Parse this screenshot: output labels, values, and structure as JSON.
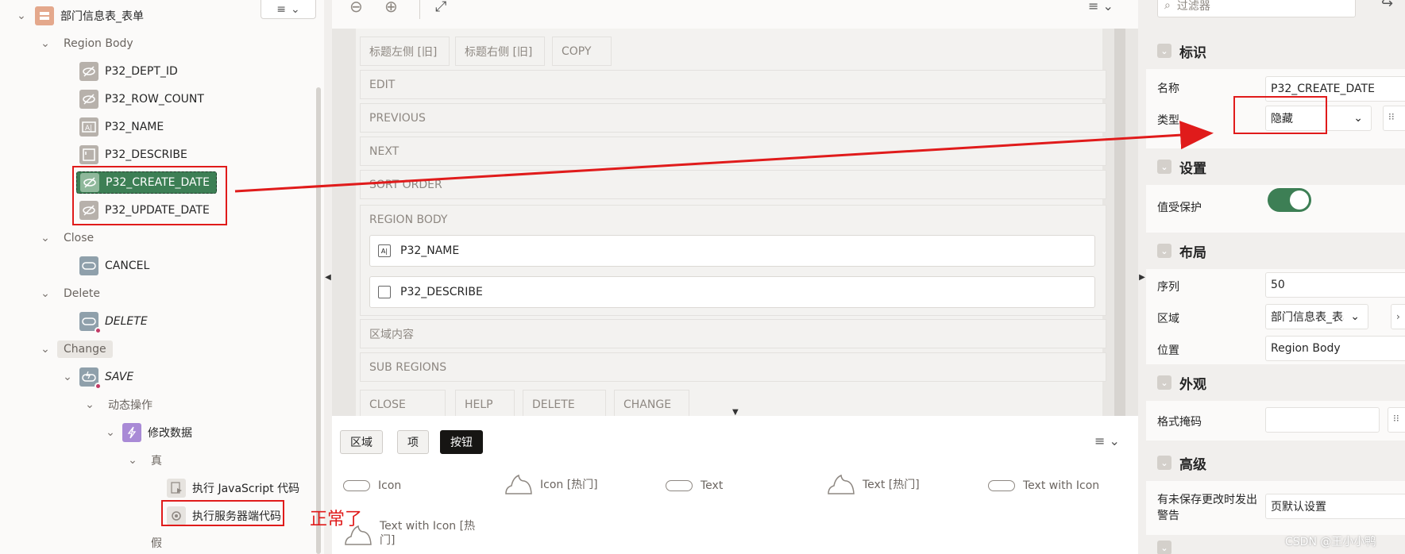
{
  "tree": {
    "root_label": "部门信息表_表单",
    "region_body": "Region Body",
    "items": [
      {
        "label": "P32_DEPT_ID"
      },
      {
        "label": "P32_ROW_COUNT"
      },
      {
        "label": "P32_NAME"
      },
      {
        "label": "P32_DESCRIBE"
      },
      {
        "label": "P32_CREATE_DATE"
      },
      {
        "label": "P32_UPDATE_DATE"
      }
    ],
    "close_label": "Close",
    "cancel_label": "CANCEL",
    "delete_group_label": "Delete",
    "delete_label": "DELETE",
    "change_label": "Change",
    "save_label": "SAVE",
    "dynamic_actions_label": "动态操作",
    "modify_data_label": "修改数据",
    "true_label": "真",
    "exec_js_label": "执行 JavaScript 代码",
    "exec_server_label": "执行服务器端代码",
    "false_label": "假"
  },
  "layout": {
    "chips_top": [
      "标题左侧 [旧]",
      "标题右侧 [旧]",
      "COPY"
    ],
    "rows": [
      "EDIT",
      "PREVIOUS",
      "NEXT",
      "SORT ORDER"
    ],
    "region_body_label": "REGION BODY",
    "items": [
      "P32_NAME",
      "P32_DESCRIBE"
    ],
    "content_label": "区域内容",
    "sub_regions_label": "SUB REGIONS",
    "chips_bottom": [
      "CLOSE",
      "HELP",
      "DELETE",
      "CHANGE"
    ]
  },
  "gallery": {
    "tabs": [
      "区域",
      "项",
      "按钮"
    ],
    "active_tab": "按钮",
    "items": [
      "Icon",
      "Icon [热门]",
      "Text",
      "Text [热门]",
      "Text with Icon",
      "Text with Icon [热门]"
    ]
  },
  "props": {
    "filter_placeholder": "过滤器",
    "identification": {
      "title": "标识",
      "name_label": "名称",
      "name_value": "P32_CREATE_DATE",
      "type_label": "类型",
      "type_value": "隐藏"
    },
    "settings": {
      "title": "设置",
      "protected_label": "值受保护",
      "protected_on": true
    },
    "layout": {
      "title": "布局",
      "sequence_label": "序列",
      "sequence_value": "50",
      "region_label": "区域",
      "region_value": "部门信息表_表单",
      "position_label": "位置",
      "position_value": "Region Body"
    },
    "appearance": {
      "title": "外观",
      "format_mask_label": "格式掩码",
      "format_mask_value": ""
    },
    "advanced": {
      "title": "高级",
      "warn_label": "有未保存更改时发出警告",
      "warn_value": "页默认设置"
    }
  },
  "annotation": {
    "text": "正常了",
    "accent": "#e01b1b"
  },
  "watermark": "CSDN @王小小鸭"
}
